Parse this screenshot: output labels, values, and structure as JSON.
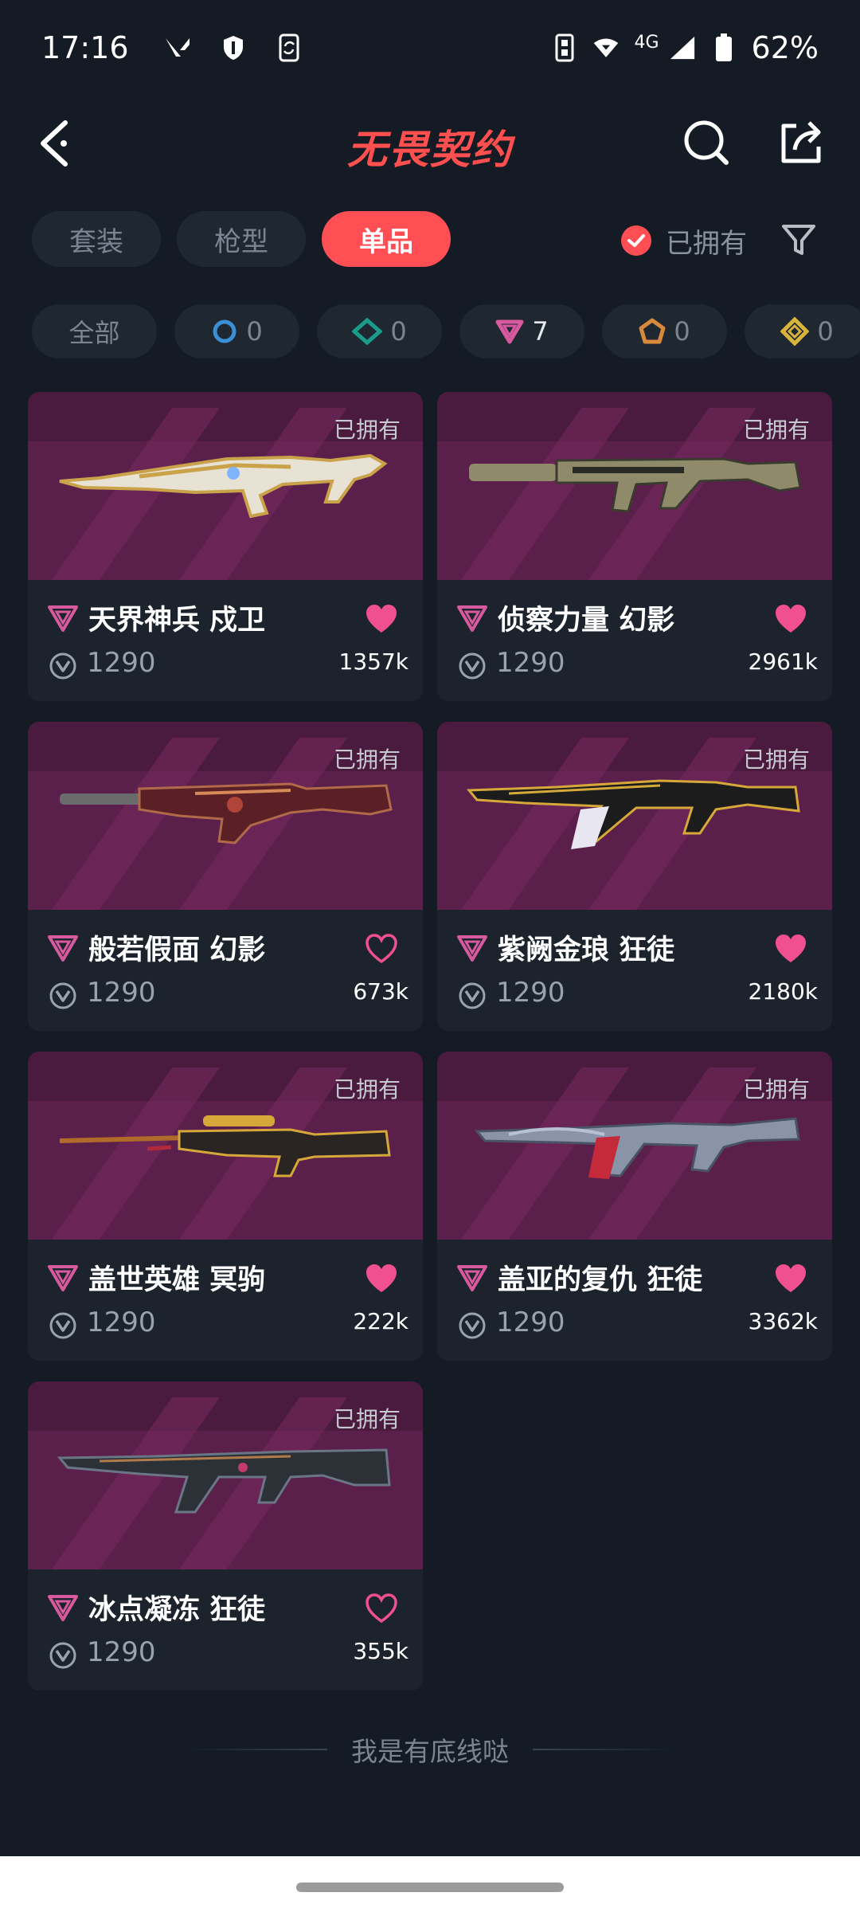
{
  "status_bar": {
    "time": "17:16",
    "network": "4G",
    "battery": "62%"
  },
  "header": {
    "title": "无畏契约"
  },
  "tabs": [
    {
      "label": "套装",
      "active": false
    },
    {
      "label": "枪型",
      "active": false
    },
    {
      "label": "单品",
      "active": true
    }
  ],
  "owned_filter": {
    "label": "已拥有",
    "checked": true
  },
  "tier_chips": [
    {
      "label": "全部"
    },
    {
      "tier": "select",
      "count": "0",
      "color": "#3a8fd6"
    },
    {
      "tier": "deluxe",
      "count": "0",
      "color": "#1a9c8a"
    },
    {
      "tier": "premium",
      "count": "7",
      "color": "#d85a9e"
    },
    {
      "tier": "exclusive",
      "count": "0",
      "color": "#d88a3a"
    },
    {
      "tier": "ultra",
      "count": "0",
      "color": "#d8b53a"
    }
  ],
  "items": [
    {
      "owned_label": "已拥有",
      "name": "天界神兵 戍卫",
      "price": "1290",
      "likes": "1357k",
      "liked": true
    },
    {
      "owned_label": "已拥有",
      "name": "侦察力量 幻影",
      "price": "1290",
      "likes": "2961k",
      "liked": true
    },
    {
      "owned_label": "已拥有",
      "name": "般若假面 幻影",
      "price": "1290",
      "likes": "673k",
      "liked": false
    },
    {
      "owned_label": "已拥有",
      "name": "紫阙金琅 狂徒",
      "price": "1290",
      "likes": "2180k",
      "liked": true
    },
    {
      "owned_label": "已拥有",
      "name": "盖世英雄 冥驹",
      "price": "1290",
      "likes": "222k",
      "liked": true
    },
    {
      "owned_label": "已拥有",
      "name": "盖亚的复仇 狂徒",
      "price": "1290",
      "likes": "3362k",
      "liked": true
    },
    {
      "owned_label": "已拥有",
      "name": "冰点凝冻 狂徒",
      "price": "1290",
      "likes": "355k",
      "liked": false
    }
  ],
  "footer": {
    "end_text": "我是有底线哒"
  },
  "colors": {
    "accent": "#ff4f55",
    "heart": "#f0508f",
    "background": "#141b24",
    "card": "#1c232d"
  }
}
